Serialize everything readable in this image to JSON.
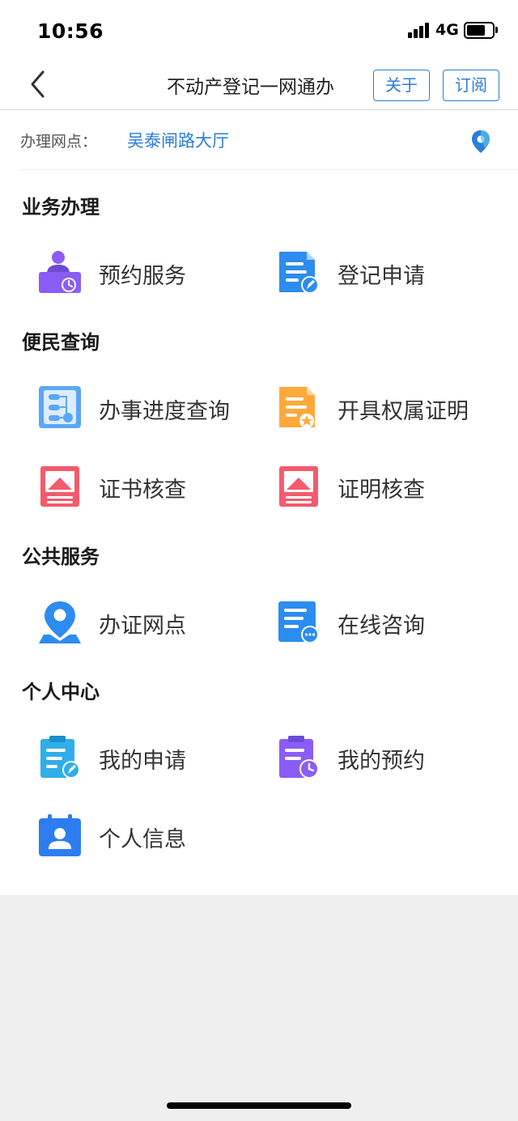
{
  "status_bar": {
    "time": "10:56",
    "network": "4G"
  },
  "header": {
    "title": "不动产登记一网通办",
    "about_label": "关于",
    "subscribe_label": "订阅"
  },
  "location": {
    "label": "办理网点：",
    "value": "吴泰闸路大厅"
  },
  "sections": {
    "business": {
      "title": "业务办理",
      "items": [
        {
          "label": "预约服务",
          "icon": "appointment-person-icon"
        },
        {
          "label": "登记申请",
          "icon": "registration-document-icon"
        }
      ]
    },
    "inquiry": {
      "title": "便民查询",
      "items": [
        {
          "label": "办事进度查询",
          "icon": "progress-flow-icon"
        },
        {
          "label": "开具权属证明",
          "icon": "ownership-certificate-icon"
        },
        {
          "label": "证书核查",
          "icon": "certificate-check-icon"
        },
        {
          "label": "证明核查",
          "icon": "proof-check-icon"
        }
      ]
    },
    "public": {
      "title": "公共服务",
      "items": [
        {
          "label": "办证网点",
          "icon": "map-pin-icon"
        },
        {
          "label": "在线咨询",
          "icon": "online-chat-icon"
        }
      ]
    },
    "personal": {
      "title": "个人中心",
      "items": [
        {
          "label": "我的申请",
          "icon": "my-application-icon"
        },
        {
          "label": "我的预约",
          "icon": "my-appointment-icon"
        },
        {
          "label": "个人信息",
          "icon": "personal-info-icon"
        }
      ]
    }
  },
  "colors": {
    "accent": "#2b7ed8",
    "purple": "#8b5cf6",
    "blue": "#2d8cf0",
    "orange": "#ffa93a",
    "red": "#f45b6c",
    "light_blue": "#5aa7f5"
  }
}
